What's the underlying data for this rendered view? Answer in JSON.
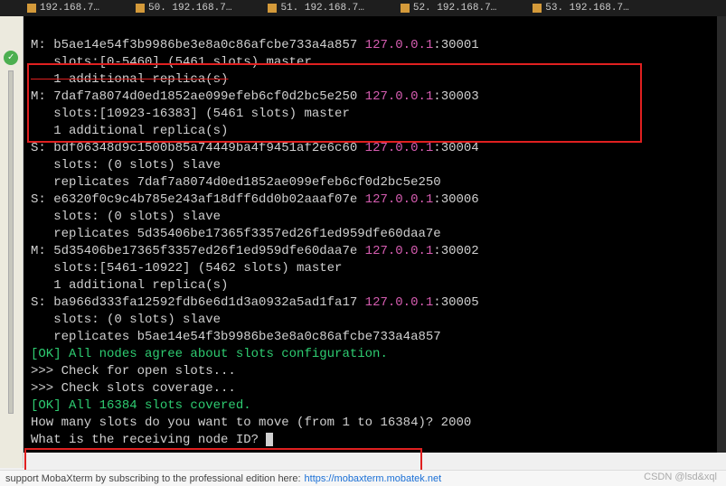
{
  "tabs": [
    {
      "label": "192.168.7…"
    },
    {
      "label": "50. 192.168.7…"
    },
    {
      "label": "51. 192.168.7…"
    },
    {
      "label": "52. 192.168.7…"
    },
    {
      "label": "53. 192.168.7…"
    }
  ],
  "gutter": {
    "check": "✓"
  },
  "term": {
    "l01a": "M: b5ae14e54f3b9986be3e8a0c86afcbe733a4a857 ",
    "l01b": "127.0.0.1",
    "l01c": ":30001",
    "l02": "   slots:[0-5460] (5461 slots) master",
    "l03": "   1 additional replica(s)",
    "l04a": "M: 7daf7a8074d0ed1852ae099efeb6cf0d2bc5e250 ",
    "l04b": "127.0.0.1",
    "l04c": ":30003",
    "l05": "   slots:[10923-16383] (5461 slots) master",
    "l06": "   1 additional replica(s)",
    "l07a": "S: bdf06348d9c1500b85a74449ba4f9451af2e6c60 ",
    "l07b": "127.0.0.1",
    "l07c": ":30004",
    "l08": "   slots: (0 slots) slave",
    "l09": "   replicates 7daf7a8074d0ed1852ae099efeb6cf0d2bc5e250",
    "l10a": "S: e6320f0c9c4b785e243af18dff6dd0b02aaaf07e ",
    "l10b": "127.0.0.1",
    "l10c": ":30006",
    "l11": "   slots: (0 slots) slave",
    "l12": "   replicates 5d35406be17365f3357ed26f1ed959dfe60daa7e",
    "l13a": "M: 5d35406be17365f3357ed26f1ed959dfe60daa7e ",
    "l13b": "127.0.0.1",
    "l13c": ":30002",
    "l14": "   slots:[5461-10922] (5462 slots) master",
    "l15": "   1 additional replica(s)",
    "l16a": "S: ba966d333fa12592fdb6e6d1d3a0932a5ad1fa17 ",
    "l16b": "127.0.0.1",
    "l16c": ":30005",
    "l17": "   slots: (0 slots) slave",
    "l18": "   replicates b5ae14e54f3b9986be3e8a0c86afcbe733a4a857",
    "l19": "[OK] All nodes agree about slots configuration.",
    "l20": ">>> Check for open slots...",
    "l21": ">>> Check slots coverage...",
    "l22": "[OK] All 16384 slots covered.",
    "l23": "How many slots do you want to move (from 1 to 16384)? 2000",
    "l24": "What is the receiving node ID? "
  },
  "footer": {
    "text": "support MobaXterm by subscribing to the professional edition here:",
    "link": "https://mobaxterm.mobatek.net"
  },
  "watermark": "CSDN @lsd&xql"
}
